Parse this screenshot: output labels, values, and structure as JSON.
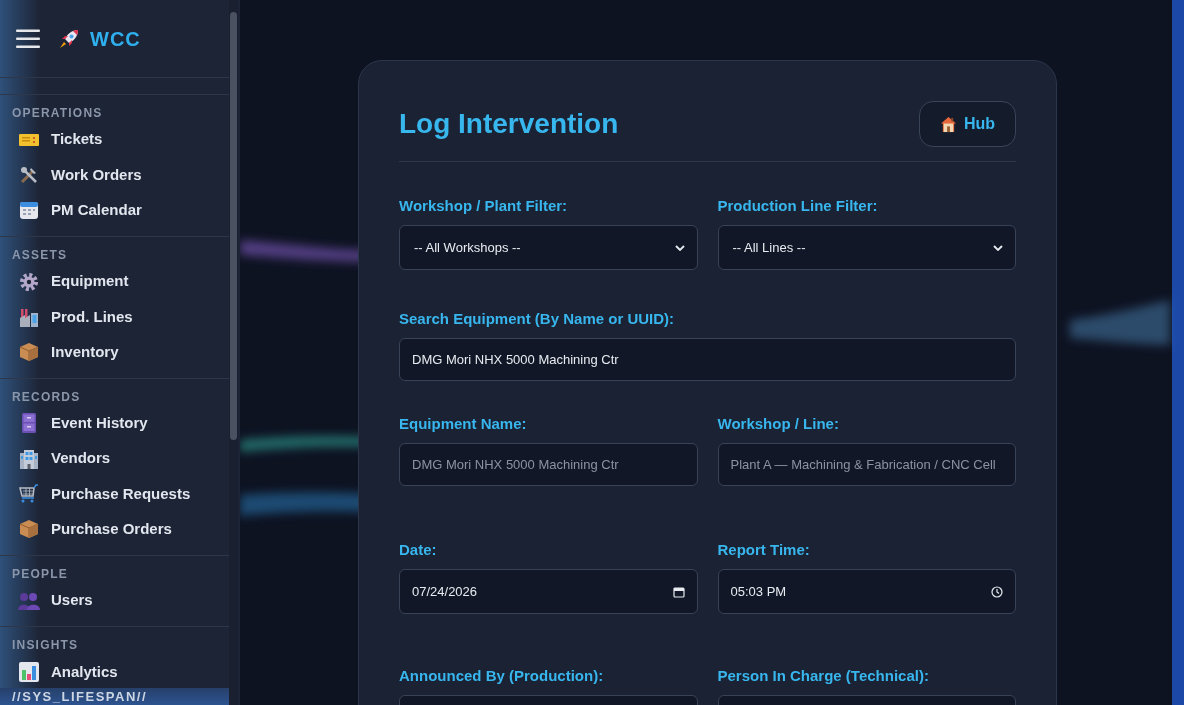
{
  "sidebar": {
    "brand": "WCC",
    "sections": [
      {
        "title": "OPERATIONS",
        "items": [
          {
            "label": "Tickets",
            "kind": "ticket"
          },
          {
            "label": "Work Orders",
            "kind": "tools"
          },
          {
            "label": "PM Calendar",
            "kind": "calendar"
          }
        ]
      },
      {
        "title": "ASSETS",
        "items": [
          {
            "label": "Equipment",
            "kind": "gear"
          },
          {
            "label": "Prod. Lines",
            "kind": "factory"
          },
          {
            "label": "Inventory",
            "kind": "box"
          }
        ]
      },
      {
        "title": "RECORDS",
        "items": [
          {
            "label": "Event History",
            "kind": "cabinet"
          },
          {
            "label": "Vendors",
            "kind": "building"
          },
          {
            "label": "Purchase Requests",
            "kind": "cart"
          },
          {
            "label": "Purchase Orders",
            "kind": "box"
          }
        ]
      },
      {
        "title": "PEOPLE",
        "items": [
          {
            "label": "Users",
            "kind": "users"
          }
        ]
      },
      {
        "title": "INSIGHTS",
        "items": [
          {
            "label": "Analytics",
            "kind": "chart"
          }
        ]
      }
    ],
    "footer": "//SYS_LIFESPAN//"
  },
  "form": {
    "title": "Log Intervention",
    "hub_button": "Hub",
    "rows": [
      [
        {
          "label": "Workshop / Plant Filter:",
          "kind": "select",
          "value": "-- All Workshops --"
        },
        {
          "label": "Production Line Filter:",
          "kind": "select",
          "value": "-- All Lines --"
        }
      ],
      [
        {
          "label": "Search Equipment (By Name or UUID):",
          "kind": "text",
          "value": "DMG Mori NHX 5000 Machining Ctr"
        }
      ],
      [
        {
          "label": "Equipment Name:",
          "kind": "readonly",
          "value": "DMG Mori NHX 5000 Machining Ctr"
        },
        {
          "label": "Workshop / Line:",
          "kind": "readonly",
          "value": "Plant A — Machining & Fabrication / CNC Cell"
        }
      ],
      [
        {
          "label": "Date:",
          "kind": "date",
          "value": "07/24/2026"
        },
        {
          "label": "Report Time:",
          "kind": "time",
          "value": "05:03 PM"
        }
      ],
      [
        {
          "label": "Announced By (Production):",
          "kind": "text"
        },
        {
          "label": "Person In Charge (Technical):",
          "kind": "text"
        }
      ]
    ]
  }
}
